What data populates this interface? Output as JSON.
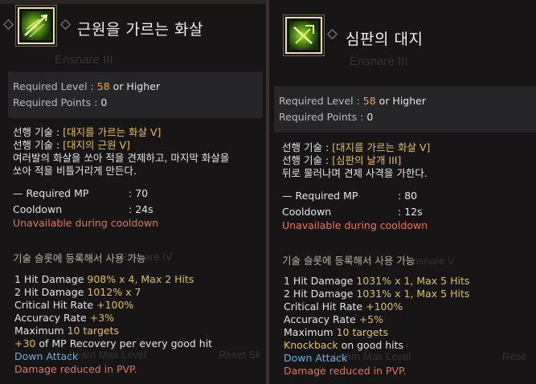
{
  "panels": [
    {
      "skill_name": "근원을 가르는 화살",
      "ghost_title": "Ensnare III",
      "required_level_label": "Required Level",
      "required_level_value": "58",
      "required_level_suffix": "or Higher",
      "required_points_label": "Required Points",
      "required_points_value": "0",
      "prereq_label": "선행 기술 :",
      "prereq_1": "[대지를 가르는 화살 V]",
      "prereq_2": "[대지의 근원 V]",
      "description_1": "여러발의 화살을 쏘아 적을 견제하고, 마지막 화살을",
      "description_2": "쏘아 적을 비틀거리게 만든다.",
      "mp_label": "Required MP",
      "mp_value": "70",
      "cooldown_label": "Cooldown",
      "cooldown_value": "24s",
      "cooldown_note": "Unavailable during cooldown",
      "slot_note": "기술 슬롯에 등록해서 사용 가능",
      "ghost_subtitle": "Ensnare IV",
      "effects": {
        "hit1_label": "1 Hit Damage",
        "hit1_value": "908% x 4, Max 2 Hits",
        "hit2_label": "2 Hit Damage",
        "hit2_value": "1012% x 7",
        "crit_label": "Critical Hit Rate",
        "crit_value": "+100%",
        "acc_label": "Accuracy Rate",
        "acc_value": "+3%",
        "max_label": "Maximum",
        "max_value": "10 targets",
        "extra_value": "+30",
        "extra_label": "of MP Recovery per every good hit",
        "attack_type": "Down Attack",
        "pvp_note": "Damage reduced in PVP."
      },
      "ghost_bottom_1": "Learn Max Level",
      "ghost_bottom_2": "Reset Sk"
    },
    {
      "skill_name": "심판의 대지",
      "ghost_title": "Ensnare III",
      "required_level_label": "Required Level",
      "required_level_value": "58",
      "required_level_suffix": "or Higher",
      "required_points_label": "Required Points",
      "required_points_value": "0",
      "prereq_label": "선행 기술 :",
      "prereq_1": "[대지를 가르는 화살 V]",
      "prereq_2": "[심판의 날개 III]",
      "description_1": "뒤로 물러나며 견제 사격을 가한다.",
      "mp_label": "Required MP",
      "mp_value": "80",
      "cooldown_label": "Cooldown",
      "cooldown_value": "12s",
      "cooldown_note": "Unavailable during cooldown",
      "slot_note": "기술 슬롯에 등록해서 사용 가능",
      "ghost_subtitle": "Ensnare V",
      "effects": {
        "hit1_label": "1 Hit Damage",
        "hit1_value": "1031% x 1, Max 5 Hits",
        "hit2_label": "2 Hit Damage",
        "hit2_value": "1031% x 1, Max 5 Hits",
        "crit_label": "Critical Hit Rate",
        "crit_value": "+100%",
        "acc_label": "Accuracy Rate",
        "acc_value": "+5%",
        "max_label": "Maximum",
        "max_value": "10 targets",
        "knock_value": "Knockback",
        "knock_label": "on good hits",
        "attack_type": "Down Attack",
        "pvp_note": "Damage reduced in PVP."
      },
      "ghost_bottom_1": "Learn Max Level",
      "ghost_bottom_2": "Rese"
    }
  ],
  "colors": {
    "orange": "#e9a83a",
    "yellow": "#e6c04a",
    "red": "#e8745a",
    "blue": "#62b3ea"
  },
  "icons": [
    "skill-arrow-icon",
    "skill-judgement-icon",
    "diamond-ornament-icon"
  ]
}
